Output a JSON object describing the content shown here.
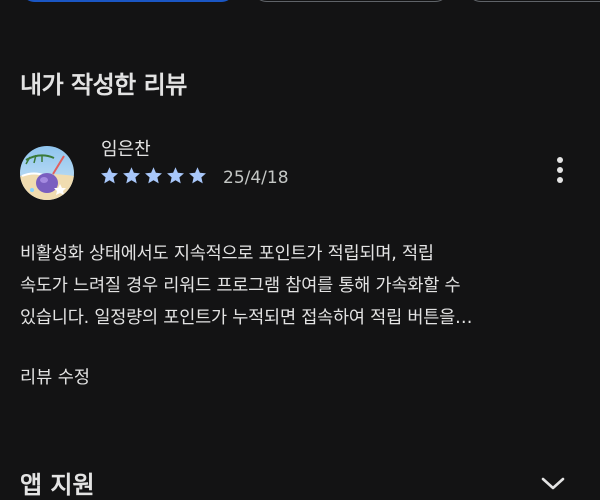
{
  "section": {
    "title": "내가 작성한 리뷰"
  },
  "review": {
    "author": "임은찬",
    "rating": 5,
    "rating_max": 5,
    "date": "25/4/18",
    "text_lines": [
      "비활성화 상태에서도 지속적으로 포인트가 적립되며, 적립",
      "속도가 느려질 경우 리워드 프로그램 참여를 통해 가속화할 수",
      "있습니다. 일정량의 포인트가 누적되면 접속하여 적립 버튼을…"
    ],
    "edit_label": "리뷰 수정",
    "more_icon": "more-vert-icon"
  },
  "app_support": {
    "title": "앱 지원",
    "icon": "chevron-down-icon"
  },
  "colors": {
    "background": "#131314",
    "text": "#e3e3e3",
    "star": "#a8c7fa",
    "primary_button": "#1a56c4",
    "outline": "#5f6368"
  }
}
